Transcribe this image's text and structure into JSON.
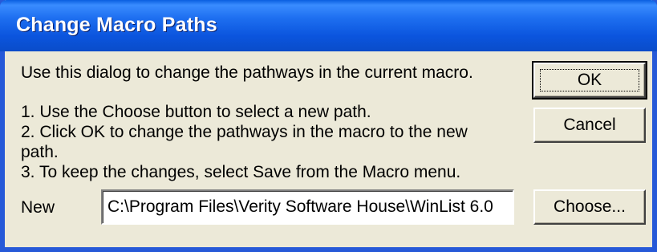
{
  "window": {
    "title": "Change Macro Paths"
  },
  "body": {
    "intro": "Use this dialog to change the pathways in the current macro.",
    "step1": "1. Use the Choose button to select a new path.",
    "step2_line1": "2. Click OK to change the pathways in the macro to the new",
    "step2_line2": "path.",
    "step3": "3. To keep the changes, select Save from the Macro menu."
  },
  "new_path": {
    "label": "New",
    "value": "C:\\Program Files\\Verity Software House\\WinList 6.0"
  },
  "buttons": {
    "ok": "OK",
    "cancel": "Cancel",
    "choose": "Choose..."
  }
}
